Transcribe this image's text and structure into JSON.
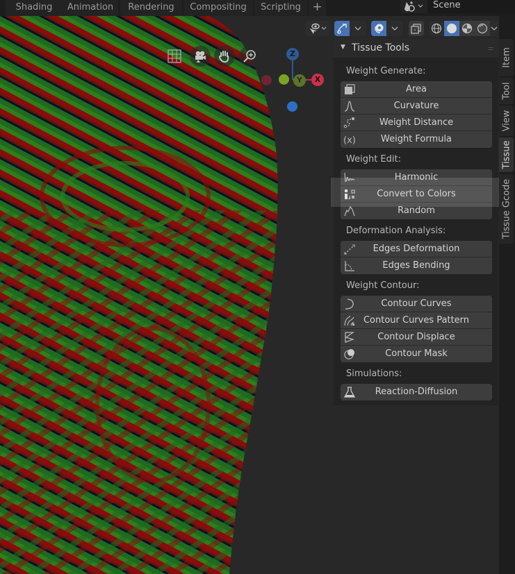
{
  "workspace_tabs": [
    "Shading",
    "Animation",
    "Rendering",
    "Compositing",
    "Scripting"
  ],
  "add_workspace_label": "+",
  "scene": {
    "icon": "scene-icon",
    "name": "Scene"
  },
  "header_tools": [
    {
      "name": "visibility-selectability",
      "icon": "eye-cursor-icon"
    },
    {
      "name": "gizmos",
      "icon": "gizmo-icon",
      "active": true
    },
    {
      "name": "overlays",
      "icon": "overlay-icon",
      "active": true
    },
    {
      "name": "xray",
      "icon": "xray-icon"
    },
    {
      "name": "shading-wireframe",
      "icon": "wireframe-sphere-icon"
    },
    {
      "name": "shading-solid",
      "icon": "solid-sphere-icon",
      "active": true
    },
    {
      "name": "shading-material",
      "icon": "material-sphere-icon"
    },
    {
      "name": "shading-rendered",
      "icon": "rendered-sphere-icon"
    }
  ],
  "navigation": {
    "buttons": [
      "toggle-camera-grid",
      "camera-view",
      "pan-view",
      "zoom-view"
    ],
    "axes": {
      "z": "Z",
      "y": "Y",
      "x": "X"
    }
  },
  "panel": {
    "title": "Tissue Tools",
    "sections": [
      {
        "label": "Weight Generate:",
        "buttons": [
          {
            "label": "Area",
            "icon": "area-icon"
          },
          {
            "label": "Curvature",
            "icon": "curvature-icon"
          },
          {
            "label": "Weight Distance",
            "icon": "weight-distance-icon"
          },
          {
            "label": "Weight Formula",
            "icon": "formula-icon"
          }
        ]
      },
      {
        "label": "Weight Edit:",
        "buttons": [
          {
            "label": "Harmonic",
            "icon": "harmonic-icon"
          },
          {
            "label": "Convert to Colors",
            "icon": "convert-colors-icon"
          },
          {
            "label": "Random",
            "icon": "random-icon"
          }
        ]
      },
      {
        "label": "Deformation Analysis:",
        "buttons": [
          {
            "label": "Edges Deformation",
            "icon": "edges-deformation-icon"
          },
          {
            "label": "Edges Bending",
            "icon": "edges-bending-icon"
          }
        ]
      },
      {
        "label": "Weight Contour:",
        "buttons": [
          {
            "label": "Contour Curves",
            "icon": "contour-curves-icon"
          },
          {
            "label": "Contour Curves Pattern",
            "icon": "contour-pattern-icon"
          },
          {
            "label": "Contour Displace",
            "icon": "contour-displace-icon"
          },
          {
            "label": "Contour Mask",
            "icon": "contour-mask-icon"
          }
        ]
      },
      {
        "label": "Simulations:",
        "buttons": [
          {
            "label": "Reaction-Diffusion",
            "icon": "flask-icon"
          }
        ]
      }
    ]
  },
  "sidebar_tabs": [
    {
      "label": "Item"
    },
    {
      "label": "Tool"
    },
    {
      "label": "View"
    },
    {
      "label": "Tissue",
      "active": true
    },
    {
      "label": "Tissue Gcode"
    }
  ],
  "colors": {
    "accent": "#4772b3",
    "axis_x": "#d4364c",
    "axis_y": "#8bb526",
    "axis_z": "#2d6fc4",
    "mesh_red": "#8a0c0c",
    "mesh_green": "#1d6e1d",
    "mesh_dark": "#0b0f2a"
  }
}
